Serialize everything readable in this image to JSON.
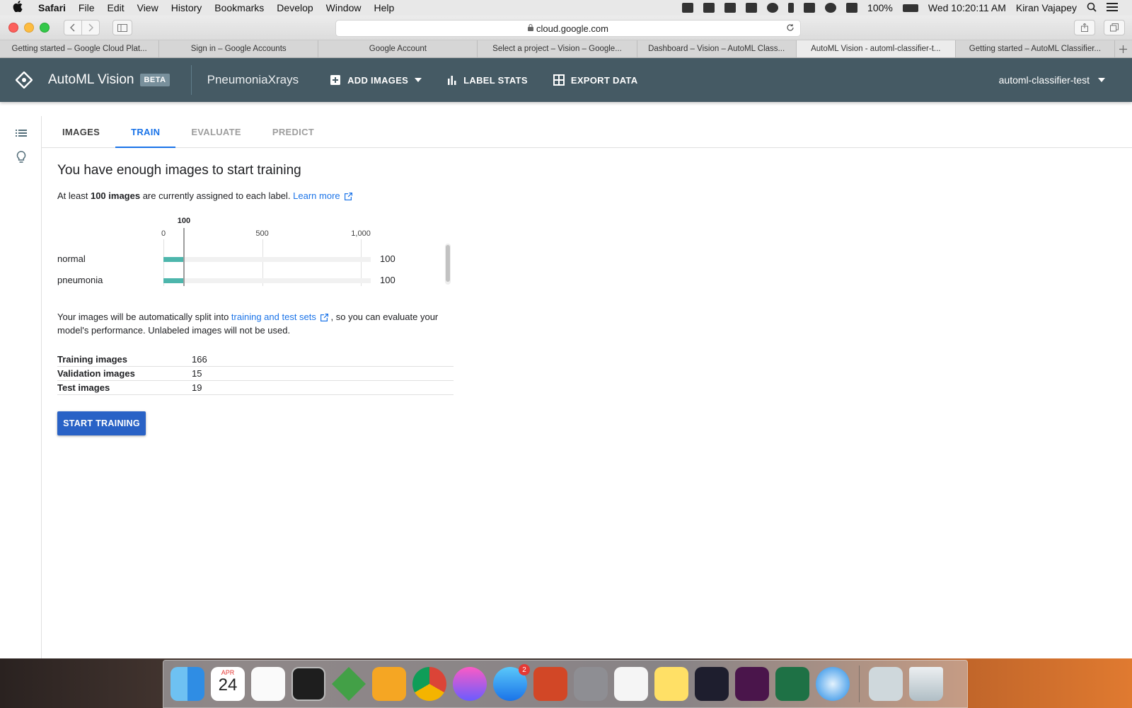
{
  "menubar": {
    "app_name": "Safari",
    "menus": [
      "File",
      "Edit",
      "View",
      "History",
      "Bookmarks",
      "Develop",
      "Window",
      "Help"
    ],
    "battery": "100%",
    "clock": "Wed 10:20:11 AM",
    "user": "Kiran Vajapey"
  },
  "browser": {
    "url": "cloud.google.com",
    "tabs": [
      "Getting started – Google Cloud Plat...",
      "Sign in – Google Accounts",
      "Google Account",
      "Select a project – Vision – Google...",
      "Dashboard – Vision – AutoML Class...",
      "AutoML Vision - automl-classifier-t...",
      "Getting started – AutoML Classifier..."
    ],
    "active_tab_index": 5
  },
  "app": {
    "product": "AutoML Vision",
    "badge": "BETA",
    "dataset": "PneumoniaXrays",
    "actions": {
      "add_images": "ADD IMAGES",
      "label_stats": "LABEL STATS",
      "export_data": "EXPORT DATA"
    },
    "project": "automl-classifier-test",
    "header_color": "#455a64"
  },
  "subtabs": [
    "IMAGES",
    "TRAIN",
    "EVALUATE",
    "PREDICT"
  ],
  "active_subtab": "TRAIN",
  "train": {
    "heading": "You have enough images to start training",
    "sub_pre": "At least ",
    "sub_bold": "100 images",
    "sub_post": " are currently assigned to each label. ",
    "learn_more": "Learn more",
    "split_pre": "Your images will be automatically split into ",
    "split_link": "training and test sets",
    "split_post": " , so you can evaluate your model's performance. Unlabeled images will not be used.",
    "split_rows": [
      {
        "label": "Training images",
        "value": "166"
      },
      {
        "label": "Validation images",
        "value": "15"
      },
      {
        "label": "Test images",
        "value": "19"
      }
    ],
    "start_button": "START TRAINING"
  },
  "chart_data": {
    "type": "bar",
    "orientation": "horizontal",
    "categories": [
      "normal",
      "pneumonia"
    ],
    "values": [
      100,
      100
    ],
    "value_labels": [
      "100",
      "100"
    ],
    "threshold": 100,
    "threshold_label": "100",
    "xlim": [
      0,
      1050
    ],
    "ticks": [
      0,
      500,
      1000
    ],
    "tick_labels": [
      "0",
      "500",
      "1,000"
    ],
    "bar_color": "#4db6ac"
  },
  "dock": {
    "apps": [
      "finder-icon",
      "calendar-icon",
      "reminders-icon",
      "terminal-icon",
      "vim-icon",
      "pages-icon",
      "chrome-icon",
      "itunes-icon",
      "app-store-icon",
      "powerpoint-icon",
      "system-preferences-icon",
      "textedit-icon",
      "notes-icon",
      "vscode-icon",
      "slack-icon",
      "excel-icon",
      "safari-icon",
      "preview-icon",
      "trash-icon"
    ],
    "calendar_month": "APR",
    "calendar_day": "24",
    "app_store_badge": "2"
  }
}
